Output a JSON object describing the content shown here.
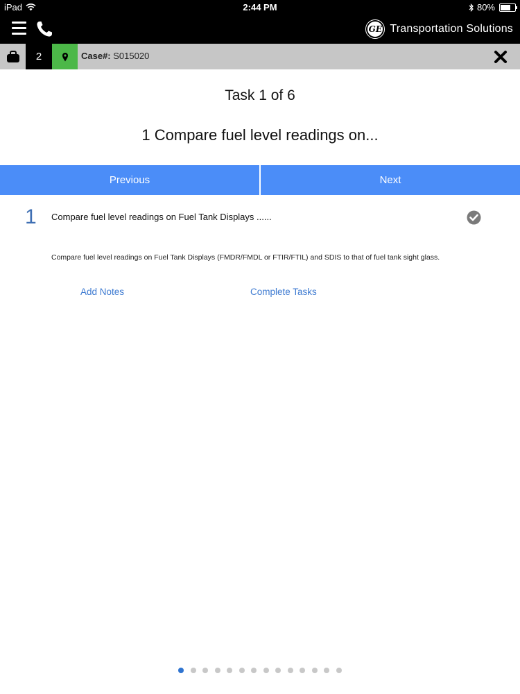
{
  "status_bar": {
    "device": "iPad",
    "time": "2:44 PM",
    "battery_percent": "80%",
    "battery_level": 0.8
  },
  "header": {
    "brand_text": "Transportation Solutions",
    "logo_letters": "GE"
  },
  "case_bar": {
    "count": "2",
    "case_label": "Case#:",
    "case_number": "S015020"
  },
  "task": {
    "counter": "Task 1 of 6",
    "title": "1 Compare fuel level readings on...",
    "number": "1",
    "summary": "Compare fuel level readings on Fuel Tank Displays ......",
    "description": "Compare fuel level readings on Fuel Tank Displays (FMDR/FMDL or FTIR/FTIL) and SDIS to that of fuel tank sight glass.",
    "status": "complete"
  },
  "nav": {
    "previous_label": "Previous",
    "next_label": "Next"
  },
  "links": {
    "add_notes": "Add Notes",
    "complete_tasks": "Complete Tasks"
  },
  "pagination": {
    "total": 14,
    "active_index": 0
  },
  "colors": {
    "nav_button": "#4b8df8",
    "link": "#3d7ad1",
    "task_number": "#3f6fb3",
    "pin_bg": "#4cb848",
    "case_bar_bg": "#c6c6c6",
    "dot_active": "#2f74d0"
  }
}
